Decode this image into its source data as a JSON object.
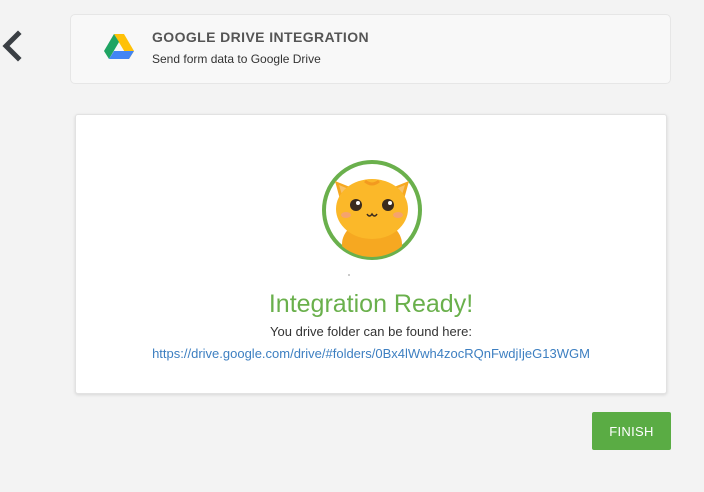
{
  "header": {
    "title": "GOOGLE DRIVE INTEGRATION",
    "subtitle": "Send form data to Google Drive",
    "logo_icon": "google-drive-icon"
  },
  "nav": {
    "back_icon": "chevron-left-icon"
  },
  "result": {
    "title": "Integration Ready!",
    "message": "You drive folder can be found here:",
    "link": "https://drive.google.com/drive/#folders/0Bx4lWwh4zocRQnFwdjIjeG13WGM",
    "mascot_icon": "cat-mascot-icon"
  },
  "actions": {
    "finish_label": "FINISH"
  },
  "colors": {
    "success_green": "#6ab04c",
    "button_green": "#5aac44",
    "link_blue": "#3d7fc1"
  }
}
